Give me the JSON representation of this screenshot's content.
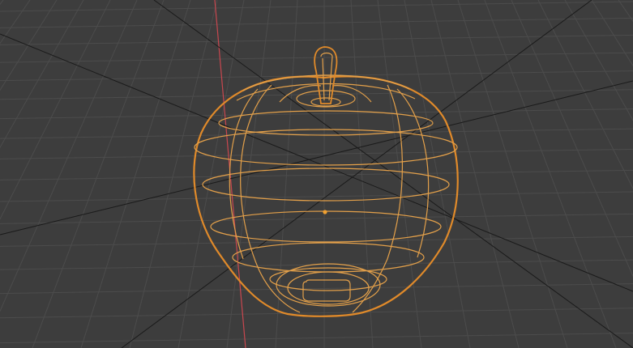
{
  "viewport": {
    "view_mode": "perspective",
    "shading": "wireframe",
    "background_color": "#3d3d3d",
    "grid_color": "#4c4c4c",
    "x_axis_color": "#c9474f",
    "guide_line_color": "#1a1a1a"
  },
  "selected_object": {
    "shape": "apple",
    "display": "wireframe",
    "selected": true,
    "outline_color": "#e08a2a",
    "edge_color": "#e3a04a",
    "origin_color": "#f0a030",
    "origin_icon": "object-origin-dot"
  }
}
